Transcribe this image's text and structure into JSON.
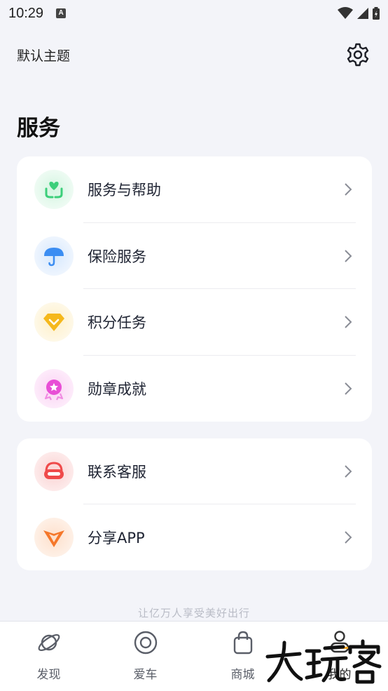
{
  "status_bar": {
    "time": "10:29",
    "badge": "A",
    "icons": [
      "wifi-icon",
      "signal-icon",
      "battery-icon"
    ]
  },
  "header": {
    "theme_label": "默认主题",
    "settings_icon": "gear-icon"
  },
  "section": {
    "title": "服务"
  },
  "service_card": {
    "items": [
      {
        "label": "服务与帮助",
        "icon": "heart-hands-icon",
        "color": "#3ccf7a"
      },
      {
        "label": "保险服务",
        "icon": "umbrella-icon",
        "color": "#3b8df2"
      },
      {
        "label": "积分任务",
        "icon": "diamond-icon",
        "color": "#f5b81c"
      },
      {
        "label": "勋章成就",
        "icon": "medal-icon",
        "color": "#e84fd6"
      }
    ]
  },
  "support_card": {
    "items": [
      {
        "label": "联系客服",
        "icon": "headset-icon",
        "color": "#ef4a4a"
      },
      {
        "label": "分享APP",
        "icon": "share-logo-icon",
        "color": "#f5772a"
      }
    ]
  },
  "slogan": "让亿万人享受美好出行",
  "tab_bar": {
    "tabs": [
      {
        "label": "发现",
        "icon": "planet-icon"
      },
      {
        "label": "爱车",
        "icon": "target-icon"
      },
      {
        "label": "商城",
        "icon": "shopping-bag-icon"
      },
      {
        "label": "我的",
        "icon": "person-icon"
      }
    ]
  },
  "watermark": {
    "text": "大玩客"
  }
}
